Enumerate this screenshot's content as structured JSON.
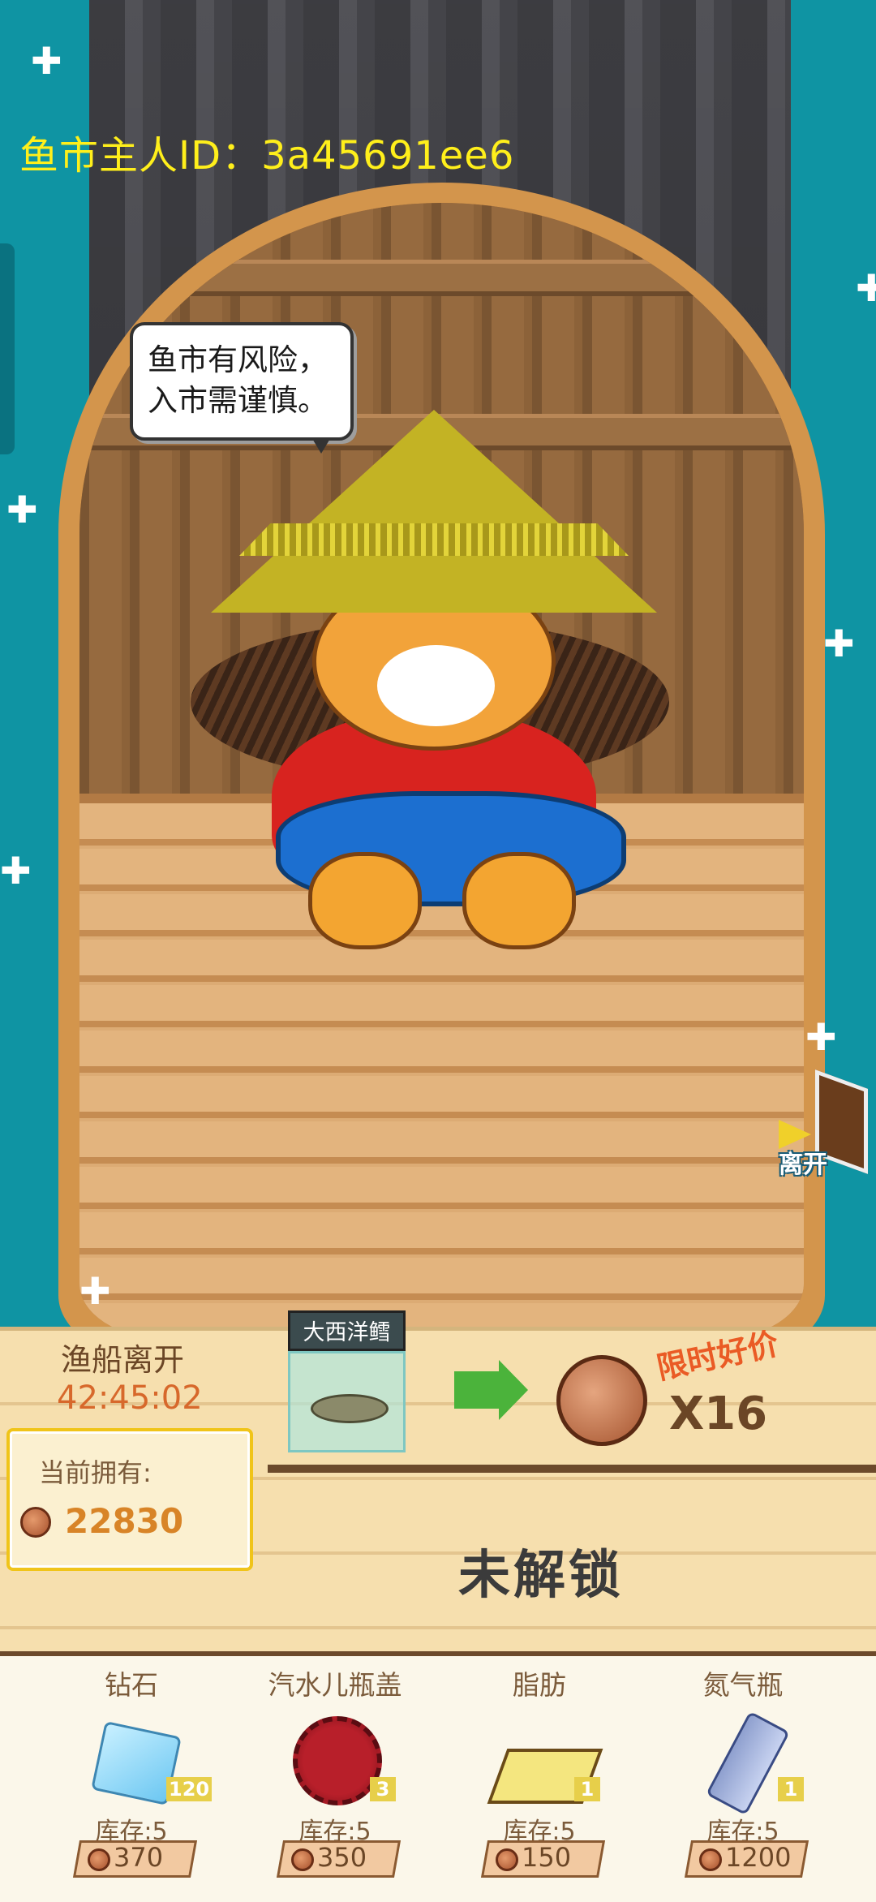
{
  "header": {
    "owner_id_label": "鱼市主人ID：3a45691ee6"
  },
  "speech": {
    "line1": "鱼市有风险，",
    "line2": "入市需谨慎。"
  },
  "leave_button": {
    "label": "离开"
  },
  "trade": {
    "depart_label": "渔船离开",
    "timer": "42:45:02",
    "owned_label": "当前拥有:",
    "owned_amount": "22830",
    "fish_name": "大西洋鳕",
    "promo_label": "限时好价",
    "multiplier": "X16",
    "status": "未解锁"
  },
  "shop": {
    "items": [
      {
        "name": "钻石",
        "qty": "120",
        "stock": "库存:5",
        "price": "370",
        "icon": "diamond-icon"
      },
      {
        "name": "汽水儿瓶盖",
        "qty": "3",
        "stock": "库存:5",
        "price": "350",
        "icon": "bottle-cap-icon"
      },
      {
        "name": "脂肪",
        "qty": "1",
        "stock": "库存:5",
        "price": "150",
        "icon": "butter-icon"
      },
      {
        "name": "氮气瓶",
        "qty": "1",
        "stock": "库存:5",
        "price": "1200",
        "icon": "n2o-bottle-icon"
      }
    ]
  },
  "colors": {
    "sea": "#0f94a3",
    "id_text": "#ffef1b",
    "timer": "#d7682b",
    "promo": "#ea5b25"
  }
}
